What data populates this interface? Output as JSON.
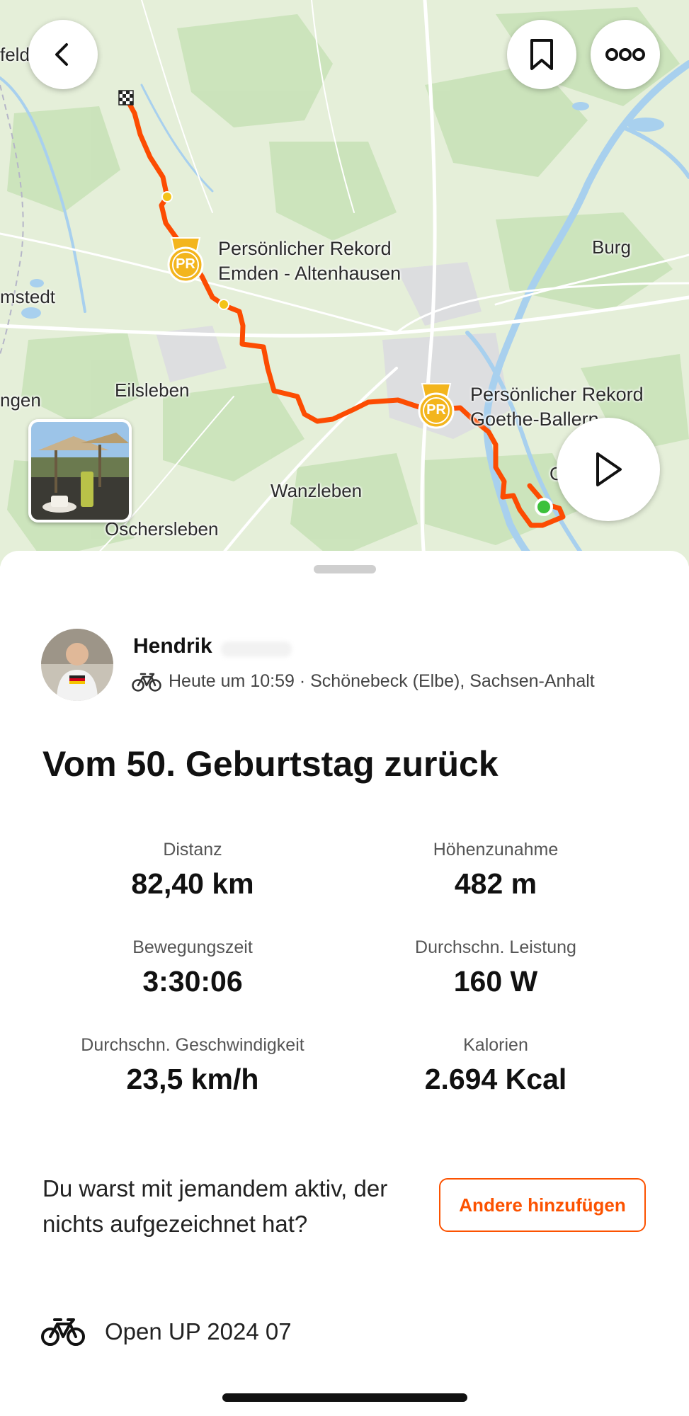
{
  "map": {
    "town_labels": [
      "feld",
      "Burg",
      "mstedt",
      "Eilsleben",
      "ngen",
      "Wanzleben",
      "Oschersleben",
      "G"
    ],
    "pr_markers": [
      {
        "badge": "PR",
        "label_line1": "Persönlicher Rekord",
        "label_line2": "Emden - Altenhausen"
      },
      {
        "badge": "PR",
        "label_line1": "Persönlicher Rekord",
        "label_line2": "Goethe-Ballern"
      }
    ],
    "route_color": "#fc4c02",
    "start_color": "#3cc13b",
    "map_background": "#e6f0dc"
  },
  "buttons": {
    "back_icon": "chevron-left-icon",
    "save_icon": "bookmark-icon",
    "more_icon": "ellipsis-icon",
    "play_icon": "play-icon"
  },
  "activity": {
    "athlete_name": "Hendrik",
    "sport_icon": "bike-icon",
    "meta": "Heute um 10:59 · Schönebeck (Elbe), Sachsen-Anhalt",
    "title": "Vom 50. Geburtstag zurück"
  },
  "stats": [
    {
      "label": "Distanz",
      "value": "82,40 km"
    },
    {
      "label": "Höhenzunahme",
      "value": "482 m"
    },
    {
      "label": "Bewegungszeit",
      "value": "3:30:06"
    },
    {
      "label": "Durchschn. Leistung",
      "value": "160 W"
    },
    {
      "label": "Durchschn. Geschwindigkeit",
      "value": "23,5 km/h"
    },
    {
      "label": "Kalorien",
      "value": "2.694 Kcal"
    }
  ],
  "others_prompt": {
    "text": "Du warst mit jemandem aktiv, der nichts aufgezeichnet hat?",
    "button_label": "Andere hinzufügen"
  },
  "gear": {
    "icon": "bike-icon",
    "name": "Open UP 2024 07"
  },
  "colors": {
    "accent": "#fc5200"
  }
}
